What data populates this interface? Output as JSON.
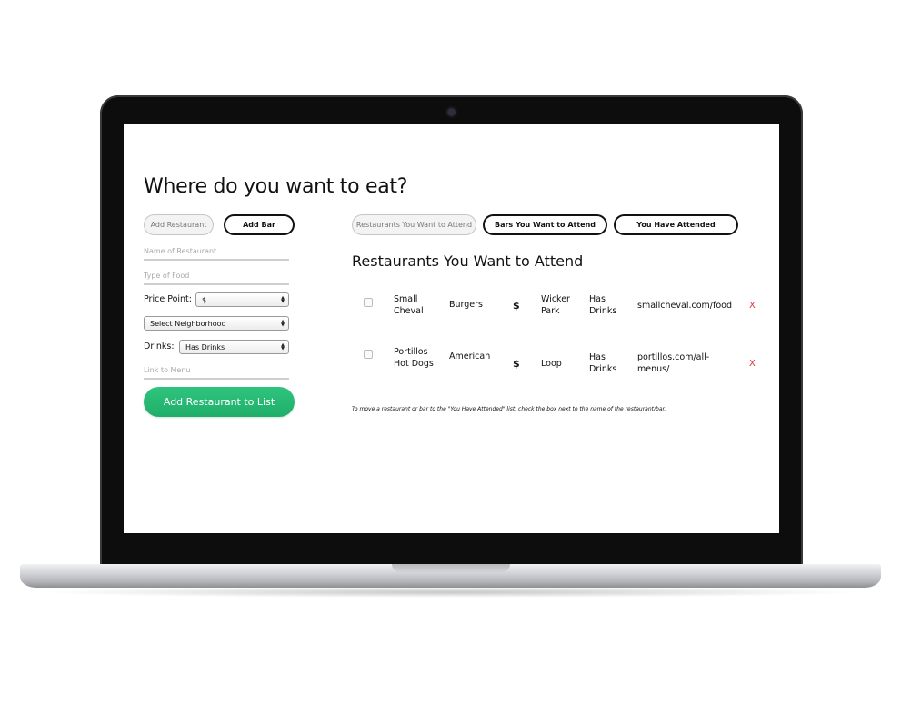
{
  "page": {
    "title": "Where do you want to eat?"
  },
  "form_tabs": [
    {
      "label": "Add Restaurant",
      "active": false
    },
    {
      "label": "Add Bar",
      "active": true
    }
  ],
  "form": {
    "name_placeholder": "Name of Restaurant",
    "type_placeholder": "Type of Food",
    "price_label": "Price Point:",
    "price_value": "$",
    "neighborhood_value": "Select Neighborhood",
    "drinks_label": "Drinks:",
    "drinks_value": "Has Drinks",
    "menu_placeholder": "Link to Menu",
    "submit_label": "Add Restaurant to List"
  },
  "list_tabs": [
    {
      "label": "Restaurants You Want to Attend",
      "active": false
    },
    {
      "label": "Bars You Want to Attend",
      "active": true
    },
    {
      "label": "You Have Attended",
      "active": true
    }
  ],
  "list": {
    "title": "Restaurants You Want to Attend",
    "rows": [
      {
        "name": "Small Cheval",
        "food": "Burgers",
        "price": "$",
        "neighborhood": "Wicker Park",
        "drinks": "Has Drinks",
        "link": "smallcheval.com/food",
        "remove": "X"
      },
      {
        "name": "Portillos Hot Dogs",
        "food": "American",
        "price": "$",
        "neighborhood": "Loop",
        "drinks": "Has Drinks",
        "link": "portillos.com/all-menus/",
        "remove": "X"
      }
    ],
    "note": "To move a restaurant or bar to the \"You Have Attended\" list, check the box next to the name of the restaurant/bar."
  },
  "colors": {
    "accent": "#1fae69",
    "remove": "#e0303a"
  }
}
